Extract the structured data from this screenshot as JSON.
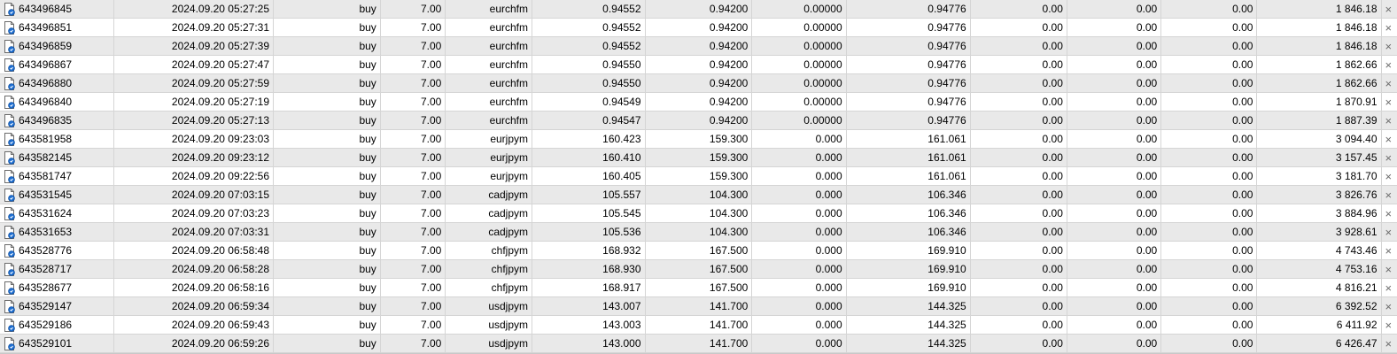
{
  "trades": [
    {
      "ticket": "643496845",
      "time": "2024.09.20 05:27:25",
      "type": "buy",
      "volume": "7.00",
      "symbol": "eurchfm",
      "price": "0.94552",
      "sl": "0.94200",
      "tp": "0.00000",
      "current": "0.94776",
      "commission": "0.00",
      "swap": "0.00",
      "tax": "0.00",
      "profit": "1 846.18"
    },
    {
      "ticket": "643496851",
      "time": "2024.09.20 05:27:31",
      "type": "buy",
      "volume": "7.00",
      "symbol": "eurchfm",
      "price": "0.94552",
      "sl": "0.94200",
      "tp": "0.00000",
      "current": "0.94776",
      "commission": "0.00",
      "swap": "0.00",
      "tax": "0.00",
      "profit": "1 846.18"
    },
    {
      "ticket": "643496859",
      "time": "2024.09.20 05:27:39",
      "type": "buy",
      "volume": "7.00",
      "symbol": "eurchfm",
      "price": "0.94552",
      "sl": "0.94200",
      "tp": "0.00000",
      "current": "0.94776",
      "commission": "0.00",
      "swap": "0.00",
      "tax": "0.00",
      "profit": "1 846.18"
    },
    {
      "ticket": "643496867",
      "time": "2024.09.20 05:27:47",
      "type": "buy",
      "volume": "7.00",
      "symbol": "eurchfm",
      "price": "0.94550",
      "sl": "0.94200",
      "tp": "0.00000",
      "current": "0.94776",
      "commission": "0.00",
      "swap": "0.00",
      "tax": "0.00",
      "profit": "1 862.66"
    },
    {
      "ticket": "643496880",
      "time": "2024.09.20 05:27:59",
      "type": "buy",
      "volume": "7.00",
      "symbol": "eurchfm",
      "price": "0.94550",
      "sl": "0.94200",
      "tp": "0.00000",
      "current": "0.94776",
      "commission": "0.00",
      "swap": "0.00",
      "tax": "0.00",
      "profit": "1 862.66"
    },
    {
      "ticket": "643496840",
      "time": "2024.09.20 05:27:19",
      "type": "buy",
      "volume": "7.00",
      "symbol": "eurchfm",
      "price": "0.94549",
      "sl": "0.94200",
      "tp": "0.00000",
      "current": "0.94776",
      "commission": "0.00",
      "swap": "0.00",
      "tax": "0.00",
      "profit": "1 870.91"
    },
    {
      "ticket": "643496835",
      "time": "2024.09.20 05:27:13",
      "type": "buy",
      "volume": "7.00",
      "symbol": "eurchfm",
      "price": "0.94547",
      "sl": "0.94200",
      "tp": "0.00000",
      "current": "0.94776",
      "commission": "0.00",
      "swap": "0.00",
      "tax": "0.00",
      "profit": "1 887.39"
    },
    {
      "ticket": "643581958",
      "time": "2024.09.20 09:23:03",
      "type": "buy",
      "volume": "7.00",
      "symbol": "eurjpym",
      "price": "160.423",
      "sl": "159.300",
      "tp": "0.000",
      "current": "161.061",
      "commission": "0.00",
      "swap": "0.00",
      "tax": "0.00",
      "profit": "3 094.40"
    },
    {
      "ticket": "643582145",
      "time": "2024.09.20 09:23:12",
      "type": "buy",
      "volume": "7.00",
      "symbol": "eurjpym",
      "price": "160.410",
      "sl": "159.300",
      "tp": "0.000",
      "current": "161.061",
      "commission": "0.00",
      "swap": "0.00",
      "tax": "0.00",
      "profit": "3 157.45"
    },
    {
      "ticket": "643581747",
      "time": "2024.09.20 09:22:56",
      "type": "buy",
      "volume": "7.00",
      "symbol": "eurjpym",
      "price": "160.405",
      "sl": "159.300",
      "tp": "0.000",
      "current": "161.061",
      "commission": "0.00",
      "swap": "0.00",
      "tax": "0.00",
      "profit": "3 181.70"
    },
    {
      "ticket": "643531545",
      "time": "2024.09.20 07:03:15",
      "type": "buy",
      "volume": "7.00",
      "symbol": "cadjpym",
      "price": "105.557",
      "sl": "104.300",
      "tp": "0.000",
      "current": "106.346",
      "commission": "0.00",
      "swap": "0.00",
      "tax": "0.00",
      "profit": "3 826.76"
    },
    {
      "ticket": "643531624",
      "time": "2024.09.20 07:03:23",
      "type": "buy",
      "volume": "7.00",
      "symbol": "cadjpym",
      "price": "105.545",
      "sl": "104.300",
      "tp": "0.000",
      "current": "106.346",
      "commission": "0.00",
      "swap": "0.00",
      "tax": "0.00",
      "profit": "3 884.96"
    },
    {
      "ticket": "643531653",
      "time": "2024.09.20 07:03:31",
      "type": "buy",
      "volume": "7.00",
      "symbol": "cadjpym",
      "price": "105.536",
      "sl": "104.300",
      "tp": "0.000",
      "current": "106.346",
      "commission": "0.00",
      "swap": "0.00",
      "tax": "0.00",
      "profit": "3 928.61"
    },
    {
      "ticket": "643528776",
      "time": "2024.09.20 06:58:48",
      "type": "buy",
      "volume": "7.00",
      "symbol": "chfjpym",
      "price": "168.932",
      "sl": "167.500",
      "tp": "0.000",
      "current": "169.910",
      "commission": "0.00",
      "swap": "0.00",
      "tax": "0.00",
      "profit": "4 743.46"
    },
    {
      "ticket": "643528717",
      "time": "2024.09.20 06:58:28",
      "type": "buy",
      "volume": "7.00",
      "symbol": "chfjpym",
      "price": "168.930",
      "sl": "167.500",
      "tp": "0.000",
      "current": "169.910",
      "commission": "0.00",
      "swap": "0.00",
      "tax": "0.00",
      "profit": "4 753.16"
    },
    {
      "ticket": "643528677",
      "time": "2024.09.20 06:58:16",
      "type": "buy",
      "volume": "7.00",
      "symbol": "chfjpym",
      "price": "168.917",
      "sl": "167.500",
      "tp": "0.000",
      "current": "169.910",
      "commission": "0.00",
      "swap": "0.00",
      "tax": "0.00",
      "profit": "4 816.21"
    },
    {
      "ticket": "643529147",
      "time": "2024.09.20 06:59:34",
      "type": "buy",
      "volume": "7.00",
      "symbol": "usdjpym",
      "price": "143.007",
      "sl": "141.700",
      "tp": "0.000",
      "current": "144.325",
      "commission": "0.00",
      "swap": "0.00",
      "tax": "0.00",
      "profit": "6 392.52"
    },
    {
      "ticket": "643529186",
      "time": "2024.09.20 06:59:43",
      "type": "buy",
      "volume": "7.00",
      "symbol": "usdjpym",
      "price": "143.003",
      "sl": "141.700",
      "tp": "0.000",
      "current": "144.325",
      "commission": "0.00",
      "swap": "0.00",
      "tax": "0.00",
      "profit": "6 411.92"
    },
    {
      "ticket": "643529101",
      "time": "2024.09.20 06:59:26",
      "type": "buy",
      "volume": "7.00",
      "symbol": "usdjpym",
      "price": "143.000",
      "sl": "141.700",
      "tp": "0.000",
      "current": "144.325",
      "commission": "0.00",
      "swap": "0.00",
      "tax": "0.00",
      "profit": "6 426.47"
    }
  ],
  "close_glyph": "×",
  "icons": {
    "ticket": "order-document-icon",
    "close": "close-icon"
  },
  "colors": {
    "row_alt": "#e9e9e9",
    "row": "#ffffff",
    "grid_line": "#d5d5d5",
    "icon_blue": "#1f6fd1"
  }
}
